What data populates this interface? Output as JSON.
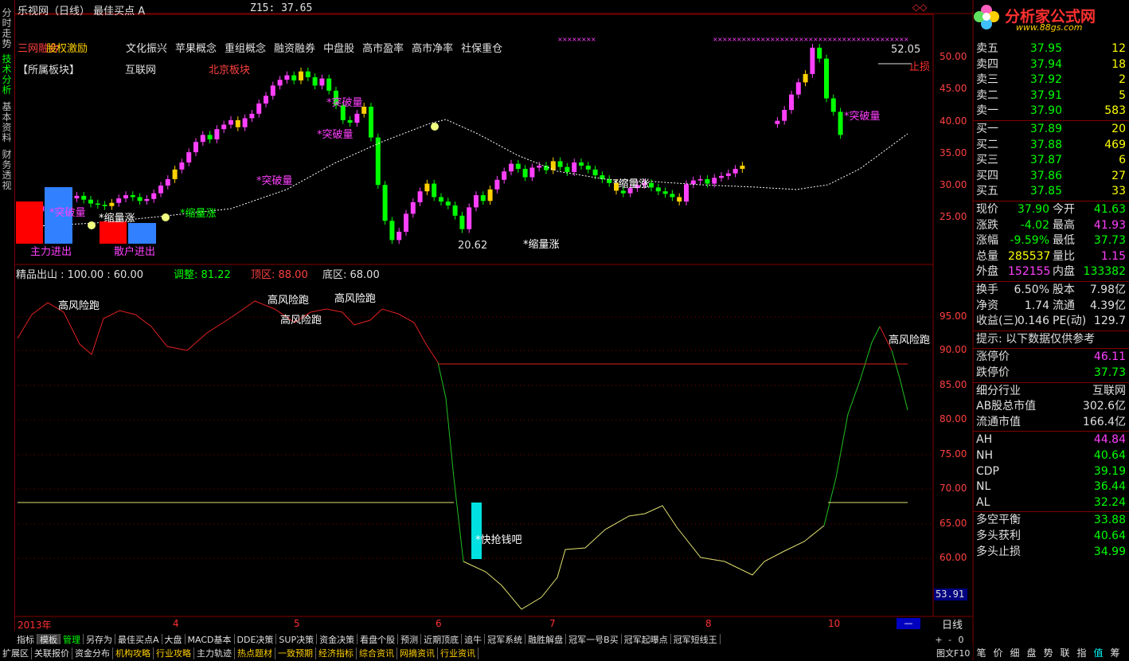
{
  "header": {
    "title": "乐视网（日线） 最佳买点 A",
    "z15": "Z15: 37.65",
    "corner_icon": "diamond-icon"
  },
  "logo": {
    "text": "分析家公式网",
    "url_text": "www.88gs.com"
  },
  "concepts": {
    "overlap_text": "三网融合",
    "overlap_text2": "股权激励",
    "items": [
      "文化振兴",
      "苹果概念",
      "重组概念",
      "融资融券",
      "中盘股",
      "高市盈率",
      "高市净率",
      "社保重仓"
    ]
  },
  "sector": {
    "label": "【所属板块】",
    "a": "互联网",
    "b": "北京板块"
  },
  "left_tabs": [
    "分时走势",
    "技术分析",
    "基本资料",
    "财务透视"
  ],
  "price_axis": [
    "50.00",
    "45.00",
    "40.00",
    "35.00",
    "30.00",
    "25.00"
  ],
  "annotations": {
    "tupo": "*突破量",
    "suoliang": "*缩量涨",
    "zhuli": "主力进出",
    "sanhu": "散户进出",
    "low": "20.62",
    "high": "52.05",
    "stop": "止损"
  },
  "indicator": {
    "title": "精品出山 : 100.00 : 60.00",
    "adjust": "调整: 81.22",
    "top": "顶区: 88.00",
    "bottom": "底区: 68.00",
    "risk": "高风险跑",
    "grab": "*快抢钱吧",
    "axis": [
      "95.00",
      "90.00",
      "85.00",
      "80.00",
      "75.00",
      "70.00",
      "65.00",
      "60.00"
    ],
    "cursor_value": "53.91"
  },
  "time_axis": {
    "year": "2013年",
    "months": [
      "4",
      "5",
      "6",
      "7",
      "8",
      "10"
    ],
    "period": "日线"
  },
  "order_book": {
    "sell": [
      {
        "label": "卖五",
        "price": "37.95",
        "vol": "12"
      },
      {
        "label": "卖四",
        "price": "37.94",
        "vol": "18"
      },
      {
        "label": "卖三",
        "price": "37.92",
        "vol": "2"
      },
      {
        "label": "卖二",
        "price": "37.91",
        "vol": "5"
      },
      {
        "label": "卖一",
        "price": "37.90",
        "vol": "583"
      }
    ],
    "buy": [
      {
        "label": "买一",
        "price": "37.89",
        "vol": "20"
      },
      {
        "label": "买二",
        "price": "37.88",
        "vol": "469"
      },
      {
        "label": "买三",
        "price": "37.87",
        "vol": "6"
      },
      {
        "label": "买四",
        "price": "37.86",
        "vol": "27"
      },
      {
        "label": "买五",
        "price": "37.85",
        "vol": "33"
      }
    ]
  },
  "quote": [
    {
      "l1": "现价",
      "v1": "37.90",
      "l2": "今开",
      "v2": "41.63",
      "c1": "#00ff00",
      "c2": "#00ff00"
    },
    {
      "l1": "涨跌",
      "v1": "-4.02",
      "l2": "最高",
      "v2": "41.93",
      "c1": "#00ff00",
      "c2": "#ff40ff"
    },
    {
      "l1": "涨幅",
      "v1": "-9.59%",
      "l2": "最低",
      "v2": "37.73",
      "c1": "#00ff00",
      "c2": "#00ff00"
    },
    {
      "l1": "总量",
      "v1": "285537",
      "l2": "量比",
      "v2": "1.15",
      "c1": "#ffff00",
      "c2": "#ff40ff"
    },
    {
      "l1": "外盘",
      "v1": "152155",
      "l2": "内盘",
      "v2": "133382",
      "c1": "#ff40ff",
      "c2": "#00ff00"
    }
  ],
  "fundamentals": [
    {
      "l1": "换手",
      "v1": "6.50%",
      "l2": "股本",
      "v2": "7.98亿"
    },
    {
      "l1": "净资",
      "v1": "1.74",
      "l2": "流通",
      "v2": "4.39亿"
    },
    {
      "l1": "收益(三)",
      "v1": "0.146",
      "l2": "PE(动)",
      "v2": "129.7"
    }
  ],
  "notice": "提示: 以下数据仅供参考",
  "limits": [
    {
      "label": "涨停价",
      "value": "46.11",
      "color": "#ff40ff"
    },
    {
      "label": "跌停价",
      "value": "37.73",
      "color": "#00ff00"
    }
  ],
  "industry": [
    {
      "label": "细分行业",
      "value": "互联网"
    },
    {
      "label": "AB股总市值",
      "value": "302.6亿"
    },
    {
      "label": "流通市值",
      "value": "166.4亿"
    }
  ],
  "pivots": [
    {
      "label": "AH",
      "value": "44.84",
      "color": "#ff40ff"
    },
    {
      "label": "NH",
      "value": "40.64",
      "color": "#00ff00"
    },
    {
      "label": "CDP",
      "value": "39.19",
      "color": "#00ff00"
    },
    {
      "label": "NL",
      "value": "36.44",
      "color": "#00ff00"
    },
    {
      "label": "AL",
      "value": "32.24",
      "color": "#00ff00"
    }
  ],
  "balance": [
    {
      "label": "多空平衡",
      "value": "33.88"
    },
    {
      "label": "多头获利",
      "value": "40.64"
    },
    {
      "label": "多头止损",
      "value": "34.99"
    }
  ],
  "toolbar1": [
    "指标",
    "模板",
    "管理",
    "另存为",
    "最佳买点A",
    "大盘",
    "MACD基本",
    "DDE决策",
    "SUP决策",
    "资金决策",
    "看盘个股",
    "预测",
    "近期顶底",
    "追牛",
    "冠军系统",
    "融胜解盘",
    "冠军一号B买",
    "冠军起曝点",
    "冠军短线王"
  ],
  "toolbar2": [
    "扩展区",
    "关联报价",
    "资金分布",
    "机构攻略",
    "行业攻略",
    "主力轨迹",
    "热点题材",
    "一致预期",
    "经济指标",
    "综合资讯",
    "网摘资讯",
    "行业资讯"
  ],
  "zoom": [
    "+",
    "-",
    "0"
  ],
  "side_tabs": [
    "笔",
    "价",
    "细",
    "盘",
    "势",
    "联",
    "指",
    "值",
    "筹"
  ],
  "status": "图文F10",
  "colors": {
    "up": "#ff40ff",
    "down": "#00ff00",
    "frame": "#800000",
    "ma": "#ffffff"
  }
}
